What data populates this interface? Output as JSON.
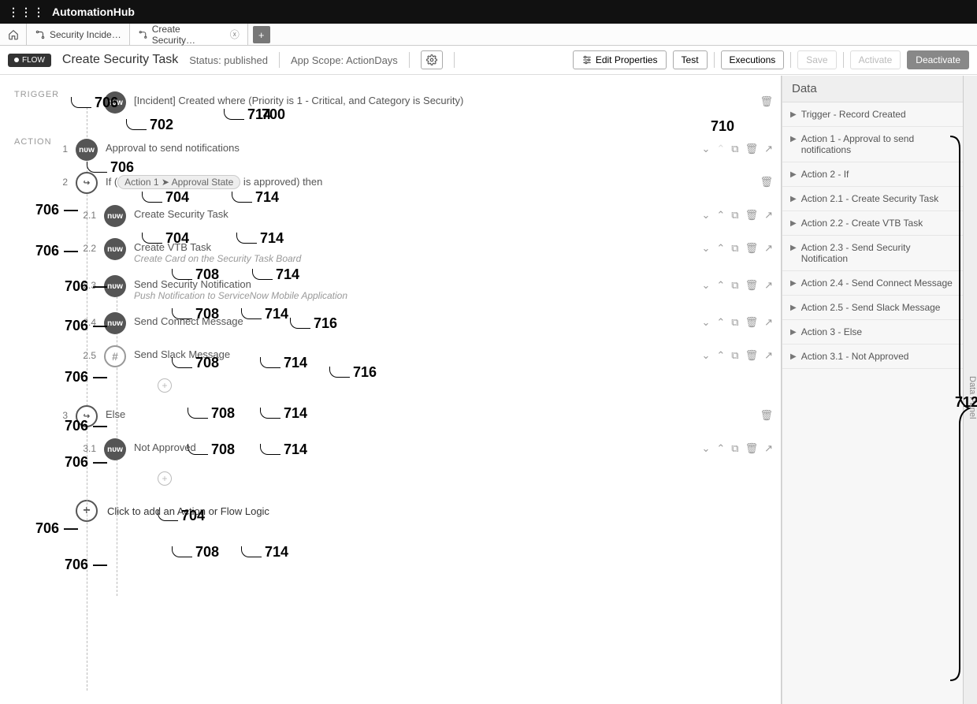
{
  "app": {
    "title": "AutomationHub"
  },
  "tabs": [
    {
      "label": "Security Incide…"
    },
    {
      "label": "Create Security…"
    }
  ],
  "toolbar": {
    "badge": "FLOW",
    "title": "Create Security Task",
    "status": "Status: published",
    "scope": "App Scope: ActionDays",
    "edit": "Edit Properties",
    "test": "Test",
    "executions": "Executions",
    "save": "Save",
    "activate": "Activate",
    "deactivate": "Deactivate"
  },
  "labels": {
    "trigger": "TRIGGER",
    "action": "ACTION"
  },
  "trigger": {
    "text": "[Incident] Created where (Priority is 1 - Critical, and Category is Security)"
  },
  "rows": [
    {
      "num": "1",
      "icon": "now",
      "title": "Approval to send notifications"
    },
    {
      "num": "2",
      "icon": "branch",
      "prefix": "If (",
      "pill": "Action 1 ➤ Approval State",
      "suffix": " is approved) then"
    },
    {
      "num": "2.1",
      "icon": "now",
      "title": "Create Security Task"
    },
    {
      "num": "2.2",
      "icon": "now",
      "title": "Create VTB Task",
      "sub": "Create Card on the Security Task Board"
    },
    {
      "num": "2.3",
      "icon": "now",
      "title": "Send Security Notification",
      "sub": "Push Notification to ServiceNow Mobile Application"
    },
    {
      "num": "2.4",
      "icon": "now",
      "title": "Send Connect Message"
    },
    {
      "num": "2.5",
      "icon": "slack",
      "title": "Send Slack Message"
    },
    {
      "num": "3",
      "icon": "branch",
      "title": "Else"
    },
    {
      "num": "3.1",
      "icon": "now",
      "title": "Not Approved"
    }
  ],
  "addrow": "Click to add an Action or Flow Logic",
  "data_panel": {
    "title": "Data",
    "items": [
      "Trigger - Record Created",
      "Action 1 - Approval to send notifications",
      "Action 2 - If",
      "Action 2.1 - Create Security Task",
      "Action 2.2 - Create VTB Task",
      "Action 2.3 - Send Security Notification",
      "Action 2.4 - Send Connect Message",
      "Action 2.5 - Send Slack Message",
      "Action 3 - Else",
      "Action 3.1 - Not Approved"
    ],
    "side": "Data Panel"
  },
  "annotations": {
    "a700": "700",
    "a702": "702",
    "a704": "704",
    "a706": "706",
    "a708": "708",
    "a710": "710",
    "a712": "712",
    "a714": "714",
    "a716": "716"
  }
}
